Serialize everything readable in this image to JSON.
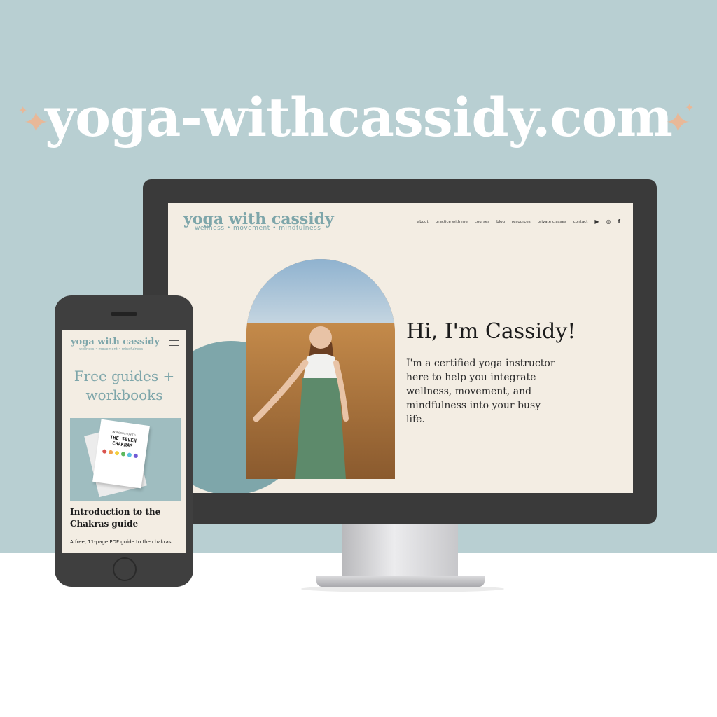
{
  "headline": "yoga-withcassidy.com",
  "colors": {
    "accent": "#7ea6aa",
    "background": "#b8cfd2",
    "sparkle": "#e8b898",
    "page": "#f3ede3"
  },
  "desktop": {
    "logo": "yoga with cassidy",
    "tagline": "wellness • movement • mindfulness",
    "nav": [
      "about",
      "practice with me",
      "courses",
      "blog",
      "resources",
      "private classes",
      "contact"
    ],
    "social_icons": [
      "youtube-icon",
      "instagram-icon",
      "facebook-icon"
    ],
    "hero_title": "Hi, I'm Cassidy!",
    "hero_body": "I'm a certified yoga instructor here to help you integrate wellness, movement, and mindfulness into your busy life."
  },
  "mobile": {
    "logo": "yoga with cassidy",
    "tagline": "wellness • movement • mindfulness",
    "heading": "Free guides + workbooks",
    "booklet_kicker": "INTRODUCTION TO",
    "booklet_title": "THE SEVEN CHAKRAS",
    "guide_title": "Introduction to the Chakras guide",
    "guide_body": "A free, 11-page PDF guide to the chakras"
  }
}
